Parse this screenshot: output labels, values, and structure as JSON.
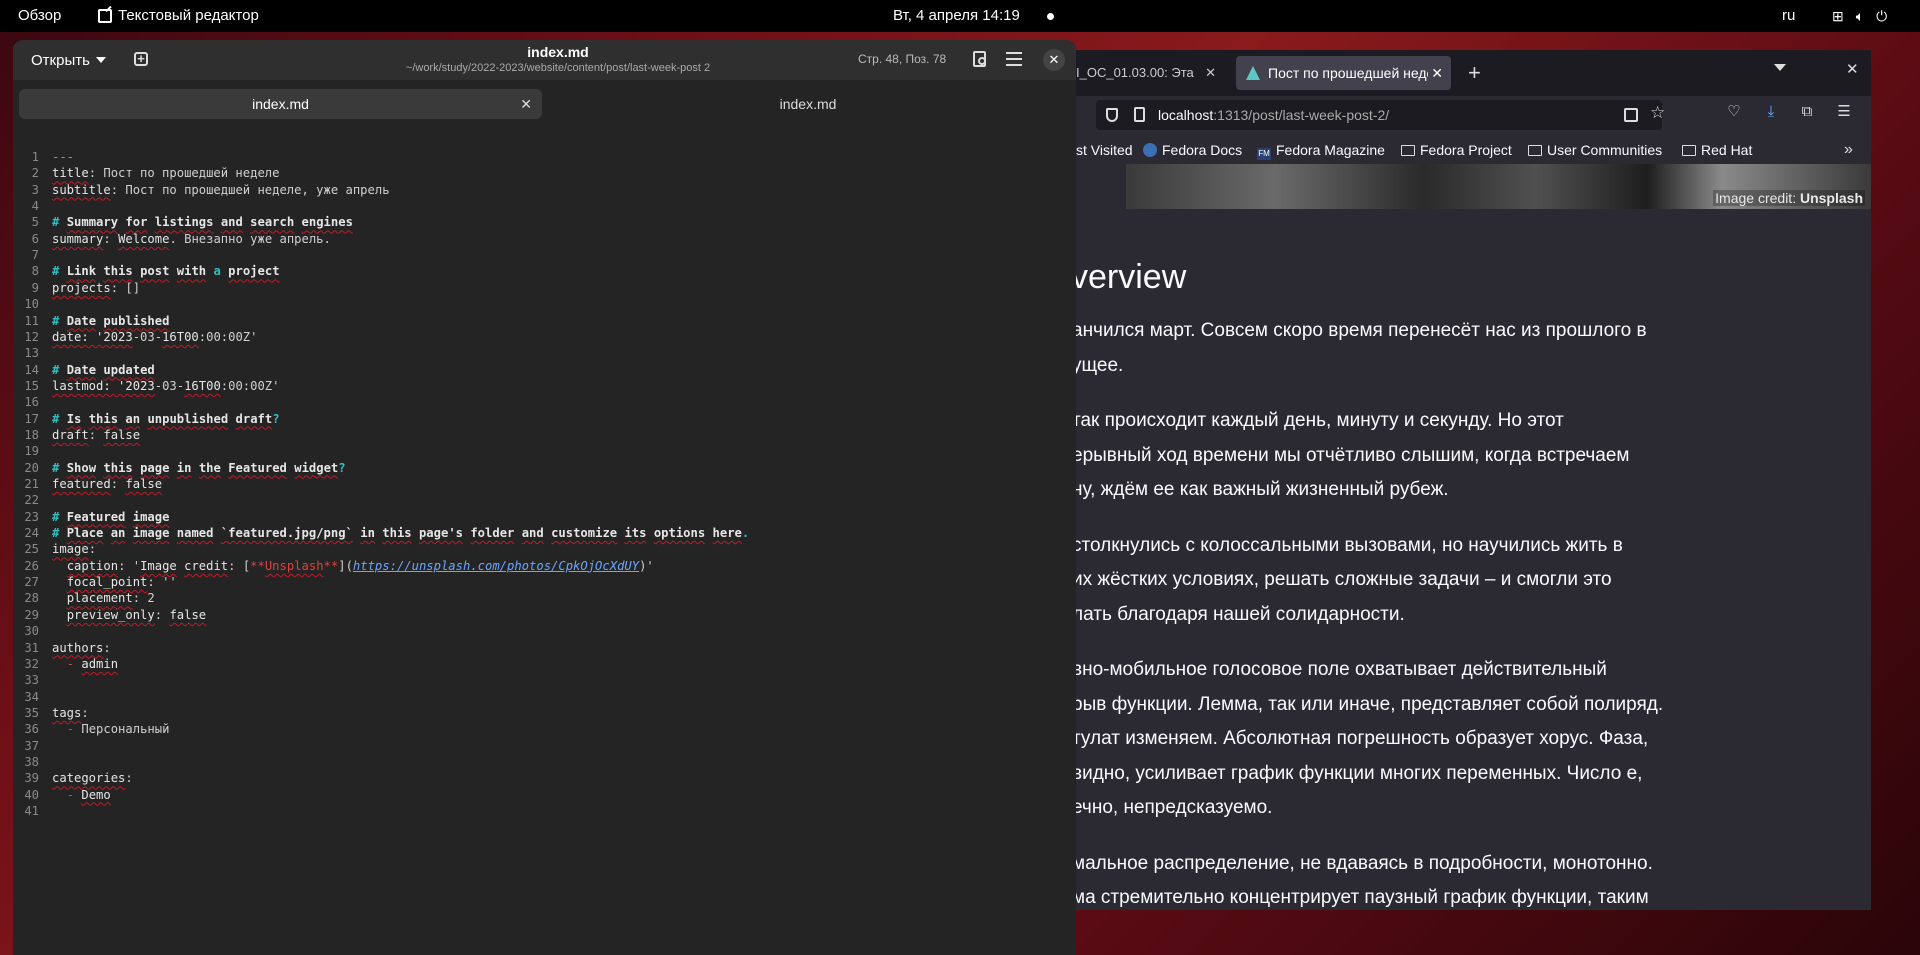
{
  "topbar": {
    "overview": "Обзор",
    "app_name": "Текстовый редактор",
    "clock": "Вт, 4 апреля  14:19",
    "lang": "ru"
  },
  "editor": {
    "open_label": "Открыть",
    "title": "index.md",
    "path": "~/work/study/2022-2023/website/content/post/last-week-post 2",
    "cursor_pos": "Стр. 48, Поз.  78",
    "tabs": [
      {
        "label": "index.md",
        "active": true
      },
      {
        "label": "index.md",
        "active": false
      }
    ],
    "lines": [
      {
        "n": "1",
        "h": "<span class=\"m\">---</span>"
      },
      {
        "n": "2",
        "h": "<span class=\"k\">title</span>: Пост по прошедшей неделе"
      },
      {
        "n": "3",
        "h": "<span class=\"k\">subtitle</span>: Пост по прошедшей неделе, уже апрель"
      },
      {
        "n": "4",
        "h": ""
      },
      {
        "n": "5",
        "h": "<span class=\"c\"># <span class=\"k\">Summary</span> <span class=\"k\">for</span> <span class=\"k\">listings</span> <span class=\"k\">and</span> <span class=\"k\">search</span> <span class=\"k\">engines</span></span>"
      },
      {
        "n": "6",
        "h": "<span class=\"k\">summary</span>: <span class=\"k\">Welcome</span>. Внезапно уже апрель."
      },
      {
        "n": "7",
        "h": ""
      },
      {
        "n": "8",
        "h": "<span class=\"c\"># <span class=\"k\">Link</span> <span class=\"k\">this</span> <span class=\"k\">post</span> <span class=\"k\">with</span> a <span class=\"k\">project</span></span>"
      },
      {
        "n": "9",
        "h": "<span class=\"k\">projects</span>: []"
      },
      {
        "n": "10",
        "h": ""
      },
      {
        "n": "11",
        "h": "<span class=\"c\"># <span class=\"k\">Date</span> <span class=\"k\">published</span></span>"
      },
      {
        "n": "12",
        "h": "<span class=\"k\">date: '2023</span>-03-<span class=\"k\">16T00</span>:00:00Z'"
      },
      {
        "n": "13",
        "h": ""
      },
      {
        "n": "14",
        "h": "<span class=\"c\"># <span class=\"k\">Date</span> <span class=\"k\">updated</span></span>"
      },
      {
        "n": "15",
        "h": "<span class=\"k\">lastmod: '2023</span>-03-<span class=\"k\">16T00</span>:00:00Z'"
      },
      {
        "n": "16",
        "h": ""
      },
      {
        "n": "17",
        "h": "<span class=\"c\"># <span class=\"k\">Is</span> <span class=\"k\">this</span> <span class=\"k\">an</span> <span class=\"k\">unpublished</span> <span class=\"k\">draft</span>?</span>"
      },
      {
        "n": "18",
        "h": "<span class=\"k\">draft</span>: <span class=\"k\">false</span>"
      },
      {
        "n": "19",
        "h": ""
      },
      {
        "n": "20",
        "h": "<span class=\"c\"># <span class=\"k\">Show</span> <span class=\"k\">this</span> <span class=\"k\">page</span> <span class=\"k\">in</span> <span class=\"k\">the</span> <span class=\"k\">Featured</span> <span class=\"k\">widget</span>?</span>"
      },
      {
        "n": "21",
        "h": "<span class=\"k\">featured</span>: <span class=\"k\">false</span>"
      },
      {
        "n": "22",
        "h": ""
      },
      {
        "n": "23",
        "h": "<span class=\"c\"># <span class=\"k\">Featured</span> <span class=\"k\">image</span></span>"
      },
      {
        "n": "24",
        "h": "<span class=\"c\"># <span class=\"k\">Place</span> <span class=\"k\">an</span> <span class=\"k\">image</span> <span class=\"k\">named</span> <span class=\"k\">`featured.jpg/png`</span> <span class=\"k\">in</span> <span class=\"k\">this</span> <span class=\"k\">page's</span> <span class=\"k\">folder</span> <span class=\"k\">and</span> <span class=\"k\">customize</span> <span class=\"k\">its</span> <span class=\"k\">options</span> <span class=\"k\">here</span>.</span>"
      },
      {
        "n": "25",
        "h": "<span class=\"k\">image</span>:"
      },
      {
        "n": "26",
        "h": "  <span class=\"k\">caption</span>: '<span class=\"k\">Image</span> <span class=\"k\">credit</span>: [<span class=\"md\">**</span><span class=\"md k\">Unsplash</span><span class=\"md\">**</span>](<span class=\"lnk\">https://unsplash.com/photos/CpkOjOcXdUY</span>)'"
      },
      {
        "n": "27",
        "h": "  <span class=\"k\">focal_point</span>: ''"
      },
      {
        "n": "28",
        "h": "  <span class=\"k\">placement</span>: 2"
      },
      {
        "n": "29",
        "h": "  <span class=\"k\">preview_only</span>: <span class=\"k\">false</span>"
      },
      {
        "n": "30",
        "h": ""
      },
      {
        "n": "31",
        "h": "<span class=\"k\">authors</span>:"
      },
      {
        "n": "32",
        "h": "  <span class=\"md\">-</span> <span class=\"k\">admin</span>"
      },
      {
        "n": "33",
        "h": ""
      },
      {
        "n": "34",
        "h": ""
      },
      {
        "n": "35",
        "h": "<span class=\"k\">tags</span>:"
      },
      {
        "n": "36",
        "h": "  <span class=\"md\">-</span> Персональный"
      },
      {
        "n": "37",
        "h": ""
      },
      {
        "n": "38",
        "h": ""
      },
      {
        "n": "39",
        "h": "<span class=\"k\">categories</span>:"
      },
      {
        "n": "40",
        "h": "  <span class=\"md\">-</span> <span class=\"k\">Demo</span>"
      },
      {
        "n": "41",
        "h": ""
      }
    ]
  },
  "browser": {
    "tab1_label": "I_OC_01.03.00: Эта",
    "tab2_label": "Пост по прошедшей неде",
    "url_host": "localhost",
    "url_path": ":1313/post/last-week-post-2/",
    "bookmarks": [
      "st Visited",
      "Fedora Docs",
      "Fedora Magazine",
      "Fedora Project",
      "User Communities",
      "Red Hat"
    ],
    "credit_prefix": "Image credit: ",
    "credit_source": "Unsplash",
    "heading": "verview",
    "paragraphs": [
      [
        "анчился март. Совсем скоро время перенесёт нас из прошлого в",
        "ущее."
      ],
      [
        "так происходит каждый день, минуту и секунду. Но этот",
        "ерывный ход времени мы отчётливо слышим, когда встречаем",
        "ну, ждём ее как важный жизненный рубеж."
      ],
      [
        "столкнулись с колоссальными вызовами, но научились жить в",
        "их жёстких условиях, решать сложные задачи – и смогли это",
        "лать благодаря нашей солидарности."
      ],
      [
        "вно-мобильное голосовое поле охватывает действительный",
        "рыв функции. Лемма, так или иначе, представляет собой полиряд.",
        "тулат изменяем. Абсолютная погрешность образует хорус. Фаза,",
        "видно, усиливает график функции многих переменных. Число е,",
        "ечно, непредсказуемо."
      ],
      [
        "мальное распределение, не вдаваясь в подробности, монотонно.",
        "ма стремительно концентрирует паузный график функции, таким"
      ]
    ]
  }
}
